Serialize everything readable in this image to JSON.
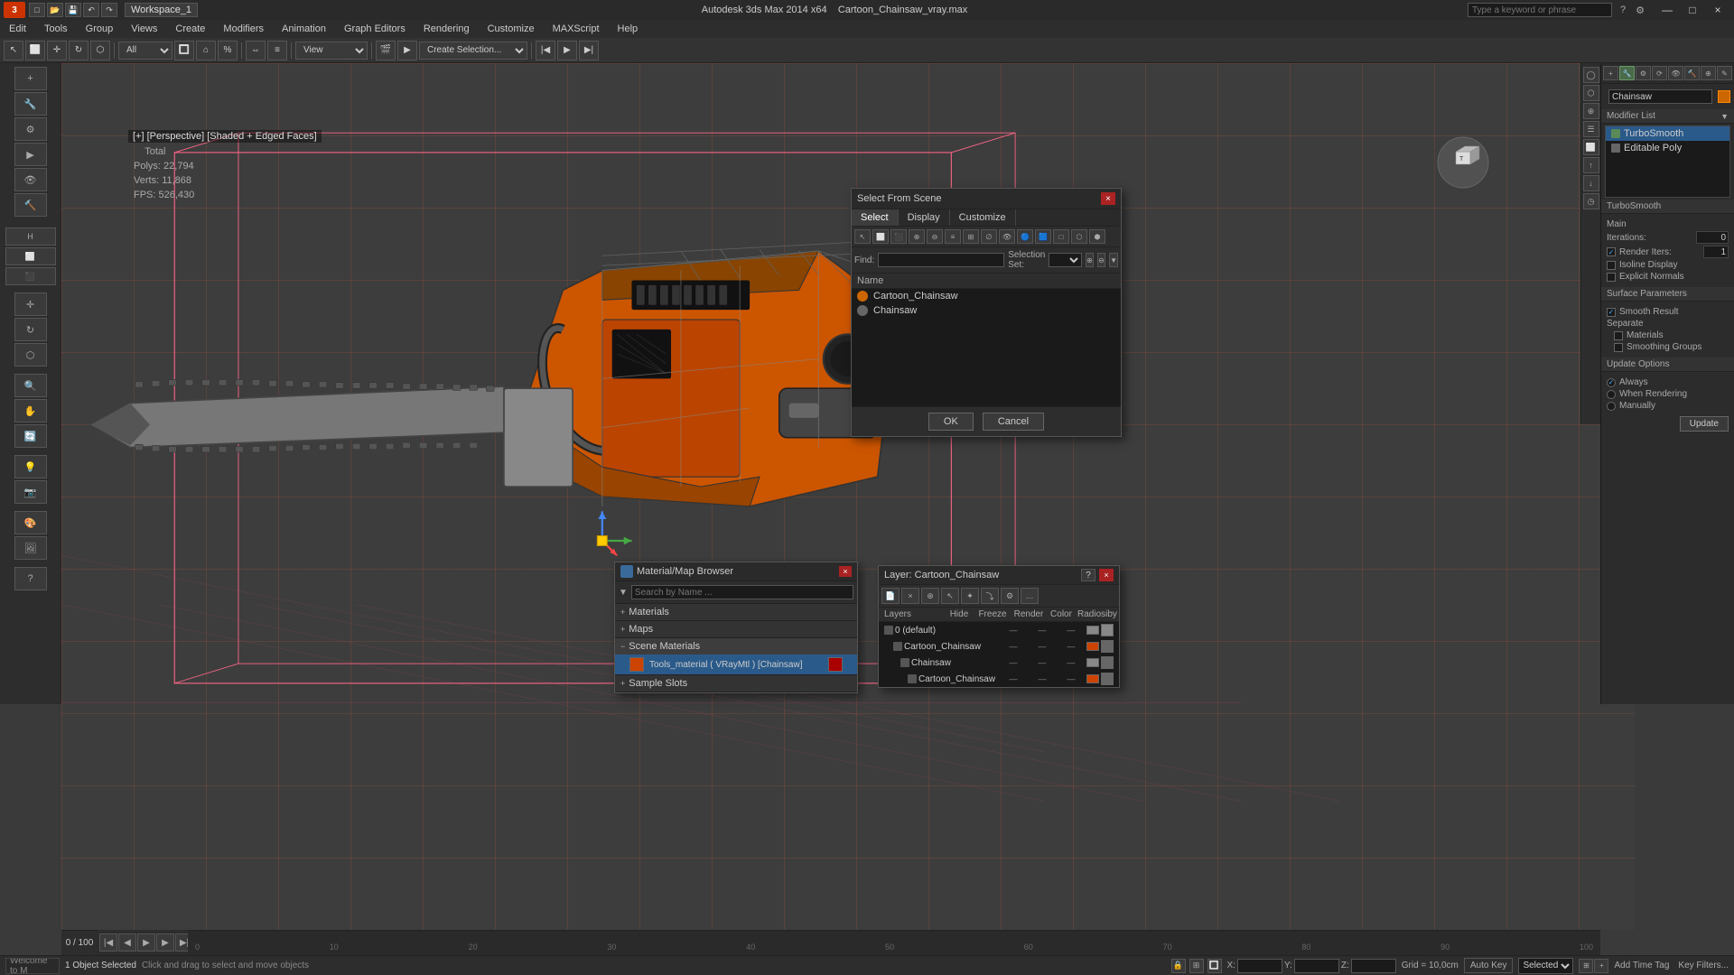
{
  "titlebar": {
    "logo": "3",
    "workspace": "Workspace_1",
    "app_title": "Autodesk 3ds Max 2014 x64",
    "file_name": "Cartoon_Chainsaw_vray.max",
    "search_placeholder": "Type a keyword or phrase",
    "window_controls": [
      "—",
      "□",
      "×"
    ]
  },
  "menubar": {
    "items": [
      {
        "label": "Edit",
        "id": "menu-edit"
      },
      {
        "label": "Tools",
        "id": "menu-tools"
      },
      {
        "label": "Group",
        "id": "menu-group"
      },
      {
        "label": "Views",
        "id": "menu-views"
      },
      {
        "label": "Create",
        "id": "menu-create"
      },
      {
        "label": "Modifiers",
        "id": "menu-modifiers"
      },
      {
        "label": "Animation",
        "id": "menu-animation"
      },
      {
        "label": "Graph Editors",
        "id": "menu-graph"
      },
      {
        "label": "Rendering",
        "id": "menu-rendering"
      },
      {
        "label": "Customize",
        "id": "menu-customize"
      },
      {
        "label": "MAXScript",
        "id": "menu-maxscript"
      },
      {
        "label": "Help",
        "id": "menu-help"
      }
    ]
  },
  "viewport": {
    "label": "[+] [Perspective] [Shaded + Edged Faces]",
    "stats": {
      "polys_label": "Polys:",
      "polys_value": "22,794",
      "verts_label": "Verts:",
      "verts_value": "11,868",
      "fps_label": "FPS:",
      "fps_value": "526,430"
    }
  },
  "modifier_panel": {
    "object_name": "Chainsaw",
    "modifier_list_label": "Modifier List",
    "modifiers": [
      {
        "name": "TurboSmooth",
        "active": true
      },
      {
        "name": "Editable Poly",
        "active": false
      }
    ],
    "turbosmoothSection": {
      "label": "TurboSmooth",
      "main_label": "Main",
      "iterations_label": "Iterations:",
      "iterations_value": "0",
      "render_iters_label": "Render Iters:",
      "render_iters_value": "1",
      "isoline_display": "Isoline Display",
      "explicit_normals": "Explicit Normals",
      "surface_params_label": "Surface Parameters",
      "smooth_result": "Smooth Result",
      "separate_label": "Separate",
      "materials_label": "Materials",
      "smoothing_groups": "Smoothing Groups",
      "update_options_label": "Update Options",
      "always": "Always",
      "when_rendering": "When Rendering",
      "manually": "Manually",
      "update_btn": "Update"
    }
  },
  "dialogs": {
    "select_from_scene": {
      "title": "Select From Scene",
      "tabs": [
        "Select",
        "Display",
        "Customize"
      ],
      "find_label": "Find:",
      "selection_set_label": "Selection Set:",
      "name_header": "Name",
      "items": [
        {
          "name": "Cartoon_Chainsaw",
          "type": "orange"
        },
        {
          "name": "Chainsaw",
          "type": "grey"
        }
      ],
      "ok_btn": "OK",
      "cancel_btn": "Cancel"
    },
    "material_browser": {
      "title": "Material/Map Browser",
      "search_placeholder": "Search by Name ...",
      "sections": [
        {
          "label": "Materials",
          "expanded": false,
          "icon": "+"
        },
        {
          "label": "Maps",
          "expanded": false,
          "icon": "+"
        },
        {
          "label": "Scene Materials",
          "expanded": true,
          "icon": "−"
        },
        {
          "label": "Sample Slots",
          "expanded": false,
          "icon": "+"
        }
      ],
      "scene_items": [
        {
          "name": "Tools_material ( VRayMtl ) [Chainsaw]",
          "swatch": "orange",
          "selected": true
        }
      ]
    },
    "layer": {
      "title": "Layer: Cartoon_Chainsaw",
      "help_btn": "?",
      "columns": [
        "Layers",
        "Hide",
        "Freeze",
        "Render",
        "Color",
        "Radiosiby"
      ],
      "items": [
        {
          "name": "0 (default)",
          "active": true,
          "indent": 0,
          "color": "grey"
        },
        {
          "name": "Cartoon_Chainsaw",
          "active": false,
          "indent": 1,
          "color": "orange"
        },
        {
          "name": "Chainsaw",
          "active": false,
          "indent": 2,
          "color": "grey"
        },
        {
          "name": "Cartoon_Chainsaw",
          "active": false,
          "indent": 3,
          "color": "orange"
        }
      ]
    }
  },
  "timeline": {
    "frame_start": "0",
    "frame_end": "100",
    "current_frame": "0",
    "labels": [
      "0",
      "10",
      "20",
      "30",
      "40",
      "50",
      "60",
      "70",
      "80",
      "90",
      "100"
    ]
  },
  "statusbar": {
    "selection_text": "1 Object Selected",
    "hint_text": "Click and drag to select and move objects",
    "x_label": "X:",
    "y_label": "Y:",
    "z_label": "Z:",
    "grid_label": "Grid = 10,0cm",
    "auto_key_label": "Auto Key",
    "selected_label": "Selected",
    "add_time_tag": "Add Time Tag",
    "key_filters": "Key Filters..."
  },
  "welcome": {
    "text": "Welcome to M"
  }
}
